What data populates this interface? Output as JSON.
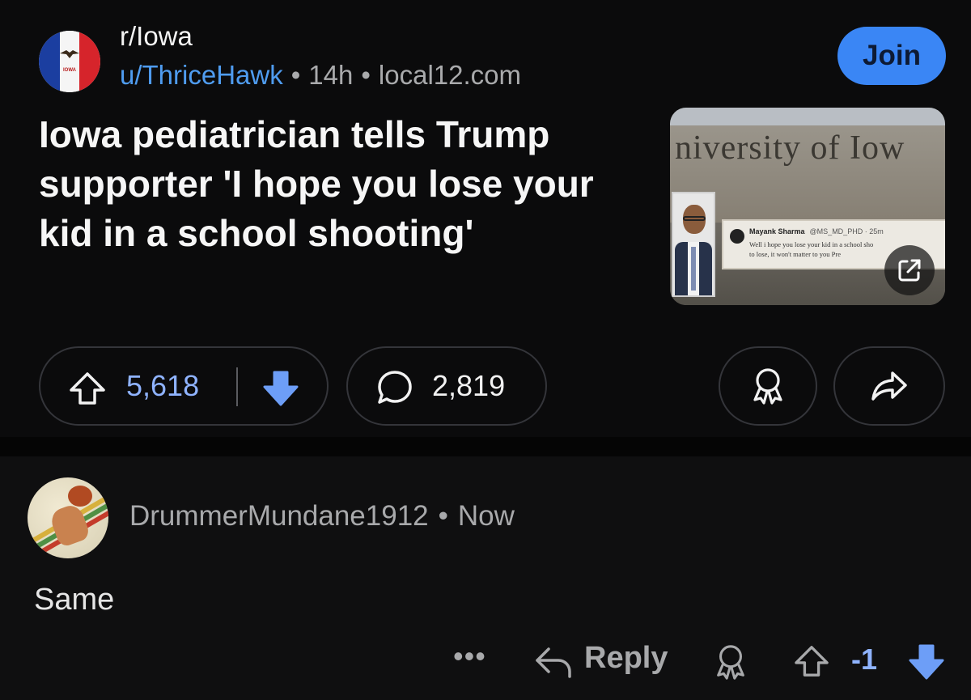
{
  "post": {
    "subreddit": "r/Iowa",
    "author": "u/ThriceHawk",
    "age": "14h",
    "domain": "local12.com",
    "join_label": "Join",
    "title": "Iowa pediatrician tells Trump supporter 'I hope you lose your kid in a school shooting'",
    "thumbnail": {
      "sign_text": "niversity of Iow",
      "tweet_name": "Mayank Sharma",
      "tweet_handle": "@MS_MD_PHD · 25m",
      "tweet_line1": "Well i hope you lose your kid in a school sho",
      "tweet_line2": "to lose, it won't matter to you   Pre",
      "flag_text": "IOWA"
    },
    "upvotes": "5,618",
    "comments": "2,819"
  },
  "comment": {
    "author": "DrummerMundane1912",
    "age": "Now",
    "body": "Same",
    "more": "•••",
    "reply_label": "Reply",
    "score": "-1"
  },
  "colors": {
    "accent": "#3a86f5",
    "link": "#4f9cf0",
    "vote": "#8fb3ff",
    "background": "#0b0b0c"
  },
  "icons": [
    "upvote-icon",
    "downvote-icon",
    "comment-icon",
    "award-icon",
    "share-icon",
    "external-link-icon",
    "reply-icon"
  ]
}
